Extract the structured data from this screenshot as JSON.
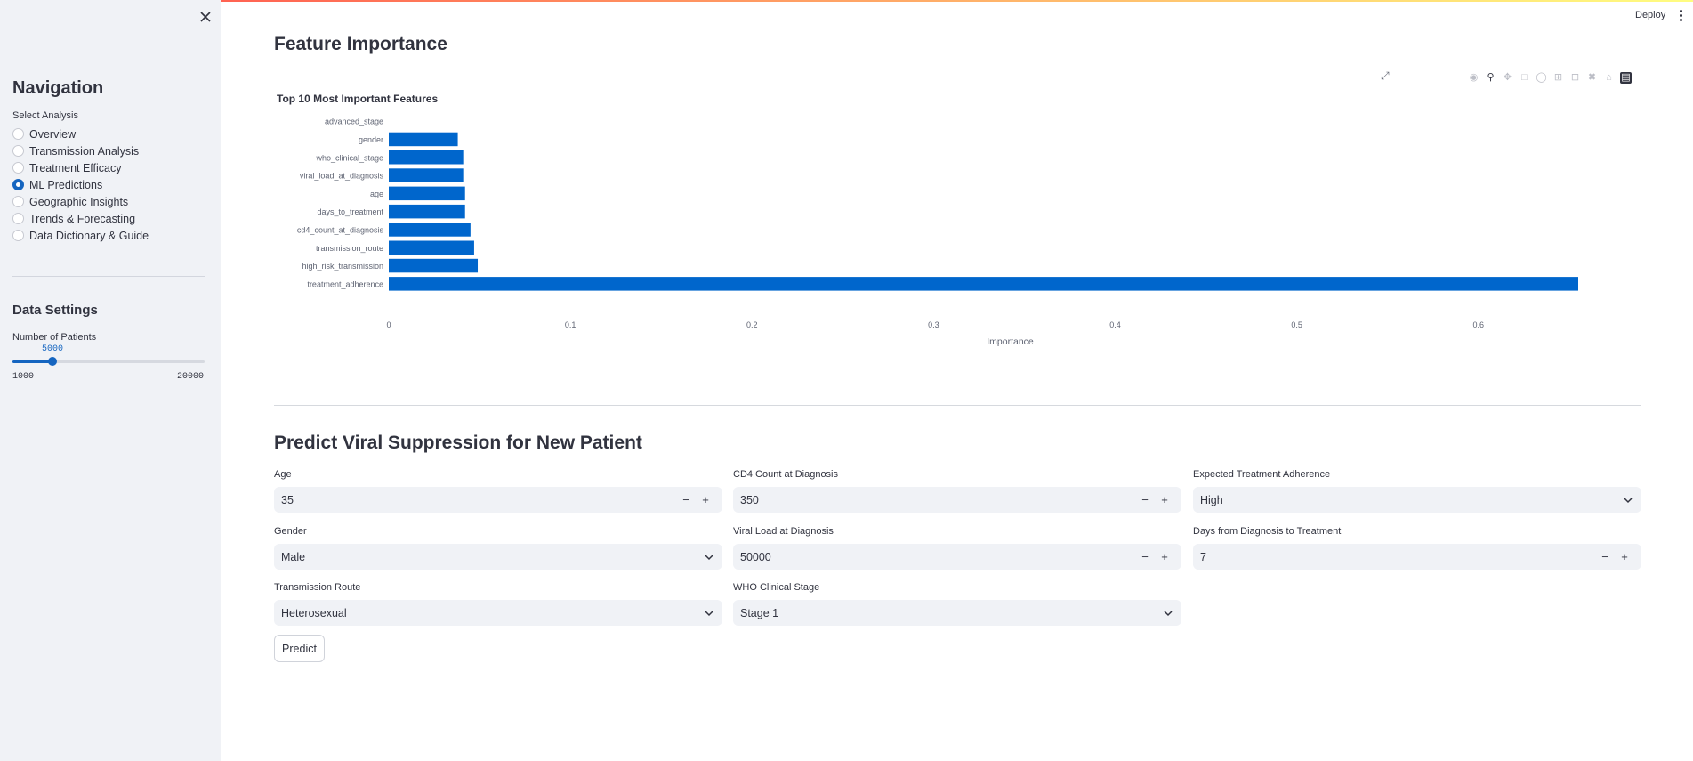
{
  "sidebar": {
    "title": "Navigation",
    "select_label": "Select Analysis",
    "items": [
      {
        "label": "Overview",
        "selected": false
      },
      {
        "label": "Transmission Analysis",
        "selected": false
      },
      {
        "label": "Treatment Efficacy",
        "selected": false
      },
      {
        "label": "ML Predictions",
        "selected": true
      },
      {
        "label": "Geographic Insights",
        "selected": false
      },
      {
        "label": "Trends & Forecasting",
        "selected": false
      },
      {
        "label": "Data Dictionary & Guide",
        "selected": false
      }
    ],
    "settings_title": "Data Settings",
    "slider": {
      "label": "Number of Patients",
      "value": "5000",
      "min": "1000",
      "max": "20000",
      "fraction": 0.21
    }
  },
  "header": {
    "deploy_label": "Deploy"
  },
  "main": {
    "title": "Feature Importance",
    "predict_title": "Predict Viral Suppression for New Patient",
    "fields": {
      "age": {
        "label": "Age",
        "value": "35"
      },
      "cd4": {
        "label": "CD4 Count at Diagnosis",
        "value": "350"
      },
      "adherence": {
        "label": "Expected Treatment Adherence",
        "value": "High"
      },
      "gender": {
        "label": "Gender",
        "value": "Male"
      },
      "viral_load": {
        "label": "Viral Load at Diagnosis",
        "value": "50000"
      },
      "days": {
        "label": "Days from Diagnosis to Treatment",
        "value": "7"
      },
      "route": {
        "label": "Transmission Route",
        "value": "Heterosexual"
      },
      "who_stage": {
        "label": "WHO Clinical Stage",
        "value": "Stage 1"
      }
    },
    "predict_button": "Predict"
  },
  "chart_data": {
    "type": "bar",
    "orientation": "horizontal",
    "title": "Top 10 Most Important Features",
    "xlabel": "Importance",
    "ylabel": "",
    "categories": [
      "advanced_stage",
      "gender",
      "who_clinical_stage",
      "viral_load_at_diagnosis",
      "age",
      "days_to_treatment",
      "cd4_count_at_diagnosis",
      "transmission_route",
      "high_risk_transmission",
      "treatment_adherence"
    ],
    "values": [
      0.0,
      0.038,
      0.041,
      0.041,
      0.042,
      0.042,
      0.045,
      0.047,
      0.049,
      0.655
    ],
    "xticks": [
      "0",
      "0.1",
      "0.2",
      "0.3",
      "0.4",
      "0.5",
      "0.6"
    ],
    "xlim": [
      0,
      0.655
    ],
    "bar_color": "#0066cc",
    "grid": false
  }
}
